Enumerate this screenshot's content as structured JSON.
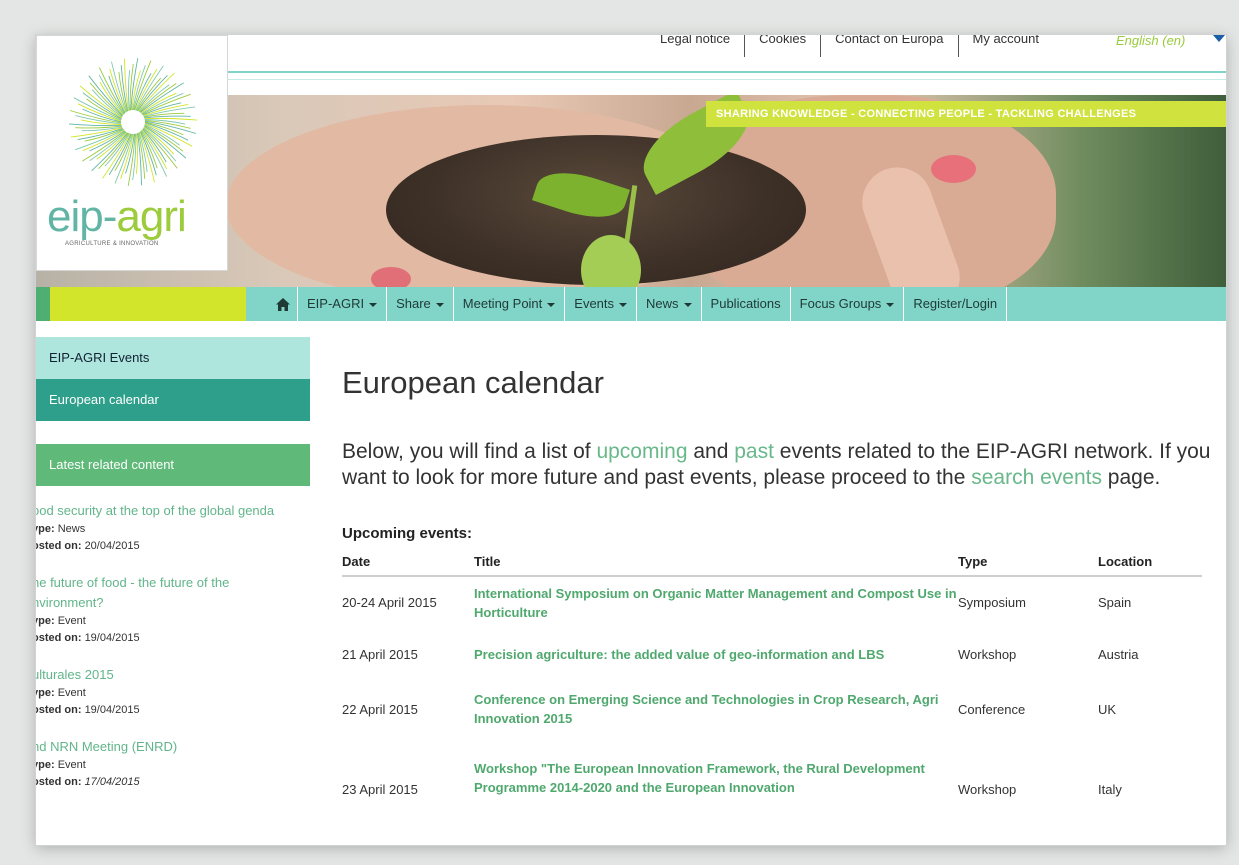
{
  "topbar": {
    "links": [
      "Legal notice",
      "Cookies",
      "Contact on Europa",
      "My account"
    ],
    "language": "English (en)"
  },
  "banner": {
    "tagline": "SHARING KNOWLEDGE - CONNECTING PEOPLE - TACKLING CHALLENGES"
  },
  "logo": {
    "name_part1": "eip-",
    "name_part2": "agri",
    "subtitle": "AGRICULTURE & INNOVATION"
  },
  "nav": {
    "items": [
      {
        "label": "EIP-AGRI",
        "dropdown": true
      },
      {
        "label": "Share",
        "dropdown": true
      },
      {
        "label": "Meeting Point",
        "dropdown": true
      },
      {
        "label": "Events",
        "dropdown": true
      },
      {
        "label": "News",
        "dropdown": true
      },
      {
        "label": "Publications",
        "dropdown": false
      },
      {
        "label": "Focus Groups",
        "dropdown": true
      },
      {
        "label": "Register/Login",
        "dropdown": false
      }
    ]
  },
  "sidebar": {
    "section": "EIP-AGRI Events",
    "active": "European calendar",
    "related_heading": "Latest related content",
    "type_label": "ype:",
    "posted_label": "osted on:",
    "entries": [
      {
        "title": "ood security at the top of the global genda",
        "type": "News",
        "posted": "20/04/2015"
      },
      {
        "title": "he future of food - the future of the nvironment?",
        "type": "Event",
        "posted": "19/04/2015"
      },
      {
        "title": "ulturales 2015",
        "type": "Event",
        "posted": "19/04/2015"
      },
      {
        "title": "nd NRN Meeting (ENRD)",
        "type": "Event",
        "posted": "17/04/2015"
      }
    ]
  },
  "main": {
    "title": "European calendar",
    "intro_1": "Below, you will find a list of ",
    "intro_upcoming": "upcoming",
    "intro_2": " and ",
    "intro_past": "past",
    "intro_3": " events related to the EIP-AGRI network. If you want to look for more future and past events, please proceed to the ",
    "intro_search": "search events",
    "intro_4": " page.",
    "upcoming_heading": "Upcoming events:",
    "table": {
      "headers": [
        "Date",
        "Title",
        "Type",
        "Location"
      ],
      "rows": [
        {
          "date": "20-24 April 2015",
          "title": "International Symposium on Organic Matter Management and Compost Use in Horticulture",
          "type": "Symposium",
          "location": "Spain"
        },
        {
          "date": "21 April 2015",
          "title": "Precision agriculture: the added value of geo-information and LBS",
          "type": "Workshop",
          "location": "Austria"
        },
        {
          "date": "22 April 2015",
          "title": "Conference on Emerging Science and Technologies in Crop Research, Agri Innovation 2015",
          "type": "Conference",
          "location": "UK"
        },
        {
          "date": "23 April 2015",
          "title": "Workshop  \"The European Innovation Framework, the Rural Development Programme 2014-2020 and the European Innovation",
          "type": "Workshop",
          "location": "Italy"
        }
      ]
    }
  },
  "colors": {
    "nav_bg": "#80d4c8",
    "accent_lime": "#d2e52a",
    "active_teal": "#2d9f8a",
    "link_green": "#4fa86d"
  }
}
